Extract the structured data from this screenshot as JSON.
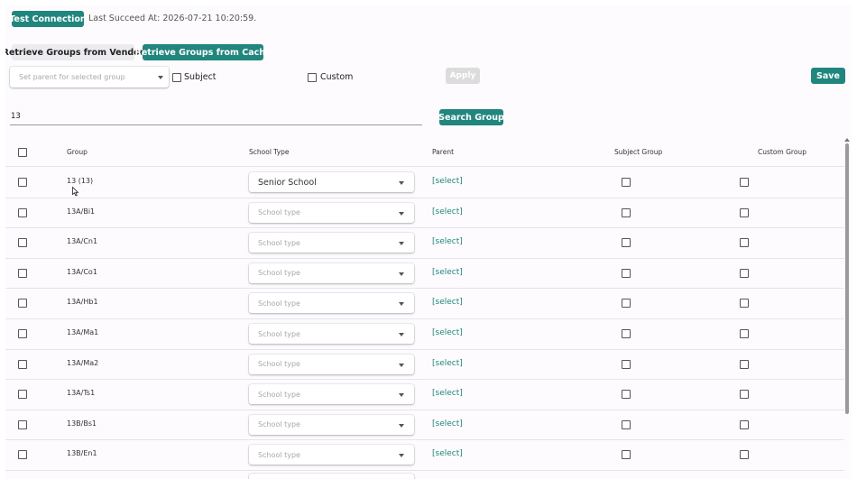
{
  "toolbar": {
    "test_connection_label": "Test Connection",
    "last_succeed": "Last Succeed At: 2026-07-21 10:20:59.",
    "retrieve_vendor_label": "Retrieve Groups from Vendor",
    "retrieve_cache_label": "Retrieve Groups from Cache"
  },
  "filters": {
    "parent_placeholder": "Set parent for selected group",
    "subject_label": "Subject",
    "custom_label": "Custom",
    "apply_label": "Apply",
    "save_label": "Save"
  },
  "search": {
    "value": "13",
    "button_label": "Search Group"
  },
  "table": {
    "headers": {
      "group": "Group",
      "school_type": "School Type",
      "parent": "Parent",
      "subject_group": "Subject Group",
      "custom_group": "Custom Group"
    },
    "rows": [
      {
        "group": "13 (13)",
        "school_type": "Senior School",
        "parent": "[select]"
      },
      {
        "group": "13A/Bi1",
        "school_type": "School type",
        "parent": "[select]"
      },
      {
        "group": "13A/Cn1",
        "school_type": "School type",
        "parent": "[select]"
      },
      {
        "group": "13A/Co1",
        "school_type": "School type",
        "parent": "[select]"
      },
      {
        "group": "13A/Hb1",
        "school_type": "School type",
        "parent": "[select]"
      },
      {
        "group": "13A/Ma1",
        "school_type": "School type",
        "parent": "[select]"
      },
      {
        "group": "13A/Ma2",
        "school_type": "School type",
        "parent": "[select]"
      },
      {
        "group": "13A/Ts1",
        "school_type": "School type",
        "parent": "[select]"
      },
      {
        "group": "13B/Bs1",
        "school_type": "School type",
        "parent": "[select]"
      },
      {
        "group": "13B/En1",
        "school_type": "School type",
        "parent": "[select]"
      }
    ]
  },
  "colors": {
    "accent": "#21867e",
    "panel_bg": "#fdfbfe",
    "placeholder": "#a8a8a8"
  }
}
